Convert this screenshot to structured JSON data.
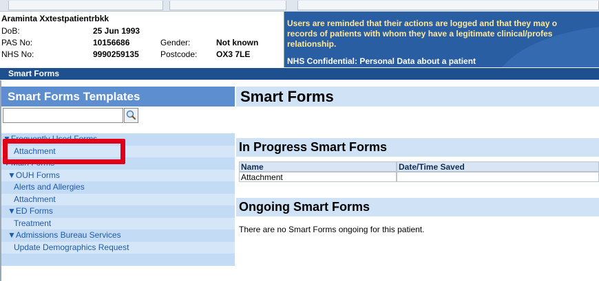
{
  "patient": {
    "name": "Araminta Xxtestpatientrbkk",
    "dob_label": "DoB:",
    "dob": "25 Jun 1993",
    "pas_label": "PAS No:",
    "pas": "10156686",
    "gender_label": "Gender:",
    "gender": "Not known",
    "nhs_label": "NHS No:",
    "nhs": "9990259135",
    "postcode_label": "Postcode:",
    "postcode": "OX3 7LE"
  },
  "banner": {
    "line1": "Users are reminded that their actions are logged and that they may o",
    "line2": "records of patients with whom they have a legitimate clinical/profes",
    "line3": "relationship.",
    "confidential": "NHS Confidential: Personal Data about a patient"
  },
  "section_bar": "Smart Forms",
  "sidebar": {
    "title": "Smart Forms Templates",
    "search_value": "",
    "tree": [
      {
        "label": "▼Frequently Used Forms",
        "indent": 0
      },
      {
        "label": "Attachment",
        "indent": 2
      },
      {
        "label": "▼Main Forms",
        "indent": 0
      },
      {
        "label": "▼OUH Forms",
        "indent": 1
      },
      {
        "label": "Alerts and Allergies",
        "indent": 2
      },
      {
        "label": "Attachment",
        "indent": 2
      },
      {
        "label": "▼ED Forms",
        "indent": 1
      },
      {
        "label": "Treatment",
        "indent": 2
      },
      {
        "label": "▼Admissions Bureau Services",
        "indent": 1
      },
      {
        "label": "Update Demographics Request",
        "indent": 2
      }
    ]
  },
  "main": {
    "title": "Smart Forms",
    "in_progress_heading": "In Progress Smart Forms",
    "table_headers": [
      "Name",
      "Date/Time Saved"
    ],
    "table_rows": [
      [
        "Attachment",
        ""
      ]
    ],
    "ongoing_heading": "Ongoing Smart Forms",
    "ongoing_note": "There are no Smart Forms ongoing for this patient."
  },
  "icons": {
    "search": "magnifier-icon"
  },
  "colors": {
    "banner": "#2a5ea3",
    "banner_text": "#ffe89a",
    "section_bar": "#1e4f8e",
    "sidebar_header": "#5d8fd0",
    "highlight": "#e0001a"
  }
}
